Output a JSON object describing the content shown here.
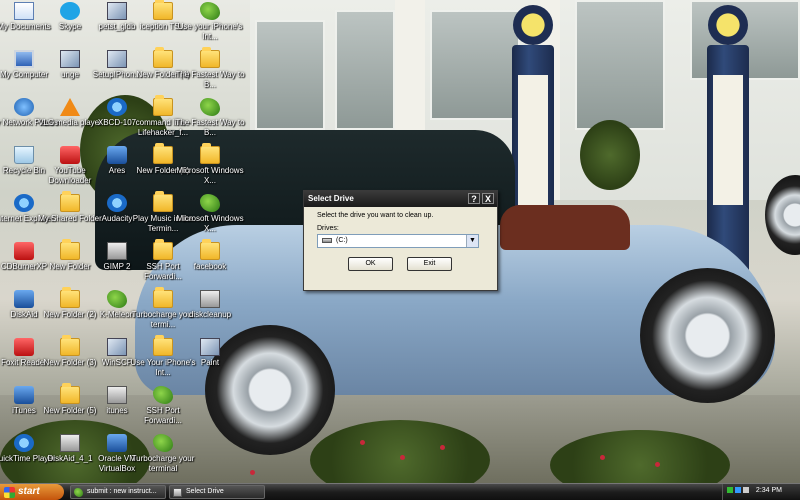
{
  "desktop": {
    "icons": [
      {
        "label": "My Documents"
      },
      {
        "label": "Skype"
      },
      {
        "label": "petst_gldb"
      },
      {
        "label": "iception TS..."
      },
      {
        "label": "Use your iPhone's Int..."
      },
      {
        "label": "My Computer"
      },
      {
        "label": "unge"
      },
      {
        "label": "SetupIPhon..."
      },
      {
        "label": "New Folder (4)"
      },
      {
        "label": "The Fastest Way to B..."
      },
      {
        "label": "My Network Places"
      },
      {
        "label": "VLC media player"
      },
      {
        "label": "XBCD-107"
      },
      {
        "label": "command line - Lifehacker_f..."
      },
      {
        "label": "The Fastest Way to B..."
      },
      {
        "label": "Recycle Bin"
      },
      {
        "label": "YouTube Downloader"
      },
      {
        "label": "Ares"
      },
      {
        "label": "New Folder (6)"
      },
      {
        "label": "Microsoft Windows X..."
      },
      {
        "label": "Internet Explorer"
      },
      {
        "label": "My Shared Folder"
      },
      {
        "label": "Audacity"
      },
      {
        "label": "Play Music in the Termin..."
      },
      {
        "label": "Microsoft Windows X..."
      },
      {
        "label": "CDBurnerXP"
      },
      {
        "label": "New Folder"
      },
      {
        "label": "GIMP 2"
      },
      {
        "label": "SSH Port Forwardi..."
      },
      {
        "label": "facebook"
      },
      {
        "label": "DiskAid"
      },
      {
        "label": "New Folder (2)"
      },
      {
        "label": "K-Meleon"
      },
      {
        "label": "Turbocharge your termi..."
      },
      {
        "label": "diskcleanup"
      },
      {
        "label": "Foxit Reader"
      },
      {
        "label": "New Folder (3)"
      },
      {
        "label": "WinSCP"
      },
      {
        "label": "Use Your iPhone's Int..."
      },
      {
        "label": "Paint"
      },
      {
        "label": "iTunes"
      },
      {
        "label": "New Folder (5)"
      },
      {
        "label": "itunes"
      },
      {
        "label": "SSH Port Forwardi..."
      },
      {
        "label": "QuickTime Player"
      },
      {
        "label": "DiskAid_4_1"
      },
      {
        "label": "Oracle VM VirtualBox"
      },
      {
        "label": "Turbocharge your terminal"
      }
    ]
  },
  "dialog": {
    "title": "Select Drive",
    "help_btn": "?",
    "close_btn": "X",
    "prompt": "Select the drive you want to clean up.",
    "drives_label": "Drives:",
    "selected_drive": "(C:)",
    "ok_label": "OK",
    "exit_label": "Exit"
  },
  "taskbar": {
    "start_label": "start",
    "tasks": [
      {
        "label": "submit : new instruct..."
      },
      {
        "label": "Select Drive"
      }
    ],
    "clock": "2:34 PM"
  }
}
